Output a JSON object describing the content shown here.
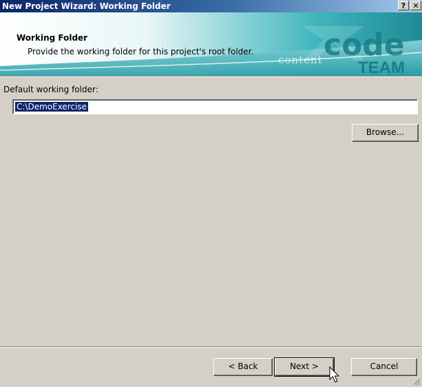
{
  "window": {
    "title": "New Project Wizard: Working Folder",
    "help_label": "?",
    "close_label": "✕"
  },
  "header": {
    "title": "Working Folder",
    "subtitle": "Provide the working folder for this project's root folder."
  },
  "brand": {
    "text_top": "code",
    "text_mid": "content",
    "text_bottom": "TEAM"
  },
  "form": {
    "folder_label": "Default working folder:",
    "folder_value": "C:\\DemoExercise",
    "browse_label": "Browse..."
  },
  "footer": {
    "back_label": "< Back",
    "next_label": "Next >",
    "cancel_label": "Cancel"
  },
  "colors": {
    "title_gradient_start": "#0a246a",
    "header_teal": "#2aa0a8",
    "selection": "#0a246a"
  },
  "icons": [
    "help-icon",
    "close-icon",
    "mouse-pointer-icon",
    "resize-grip-icon"
  ]
}
